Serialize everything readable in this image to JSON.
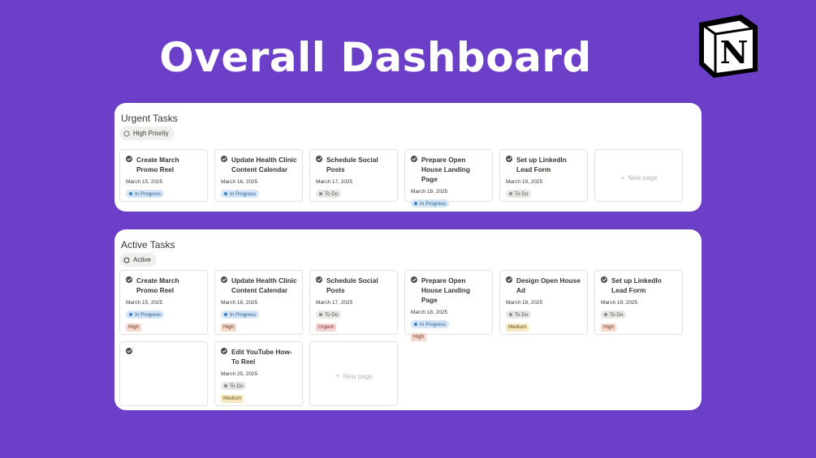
{
  "hero": {
    "title": "Overall Dashboard"
  },
  "notion_logo": {
    "letter": "N"
  },
  "urgent": {
    "title": "Urgent Tasks",
    "view_label": "High Priority",
    "cards": [
      {
        "title": "Create March Promo Reel",
        "date": "March 15, 2025",
        "status": "In Progress"
      },
      {
        "title": "Update Health Clinic Content Calendar",
        "date": "March 16, 2025",
        "status": "In Progress"
      },
      {
        "title": "Schedule Social Posts",
        "date": "March 17, 2025",
        "status": "To Do"
      },
      {
        "title": "Prepare Open House Landing Page",
        "date": "March 18, 2025",
        "status": "In Progress"
      },
      {
        "title": "Set up LinkedIn Lead Form",
        "date": "March 19, 2025",
        "status": "To Do"
      }
    ],
    "new_page_label": "New page"
  },
  "active": {
    "title": "Active Tasks",
    "view_label": "Active",
    "cards": [
      {
        "title": "Create March Promo Reel",
        "date": "March 15, 2025",
        "status": "In Progress",
        "priority": "High"
      },
      {
        "title": "Update Health Clinic Content Calendar",
        "date": "March 16, 2025",
        "status": "In Progress",
        "priority": "High"
      },
      {
        "title": "Schedule Social Posts",
        "date": "March 17, 2025",
        "status": "To Do",
        "priority": "Urgent"
      },
      {
        "title": "Prepare Open House Landing Page",
        "date": "March 18, 2025",
        "status": "In Progress",
        "priority": "High"
      },
      {
        "title": "Design Open House Ad",
        "date": "March 18, 2025",
        "status": "To Do",
        "priority": "Medium"
      },
      {
        "title": "Set up LinkedIn Lead Form",
        "date": "March 19, 2025",
        "status": "To Do",
        "priority": "High"
      },
      {
        "title": "Edit YouTube How-To Reel",
        "date": "March 25, 2025",
        "status": "To Do",
        "priority": "Medium"
      }
    ],
    "new_page_label": "New page"
  },
  "colors": {
    "background": "#6b3fc7",
    "in_progress": "#d3e5f6",
    "to_do": "#e6e6e4",
    "high": "#f5d9cc",
    "urgent": "#f7d5d3",
    "medium": "#f6e8c1"
  }
}
